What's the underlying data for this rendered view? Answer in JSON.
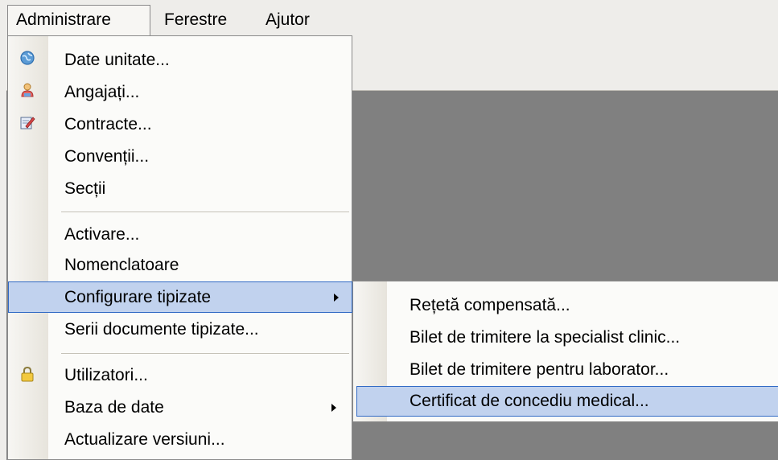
{
  "menubar": {
    "items": [
      {
        "label": "Administrare"
      },
      {
        "label": "Ferestre"
      },
      {
        "label": "Ajutor"
      }
    ]
  },
  "admin_menu": {
    "items": [
      {
        "label": "Date unitate...",
        "icon": "globe-icon"
      },
      {
        "label": "Angajați...",
        "icon": "user-icon"
      },
      {
        "label": "Contracte...",
        "icon": "edit-document-icon"
      },
      {
        "label": "Convenții..."
      },
      {
        "label": "Secții"
      },
      {
        "label": "Activare..."
      },
      {
        "label": "Nomenclatoare"
      },
      {
        "label": "Configurare tipizate",
        "submenu": true,
        "highlighted": true
      },
      {
        "label": "Serii documente tipizate..."
      },
      {
        "label": "Utilizatori...",
        "icon": "lock-icon"
      },
      {
        "label": "Baza de date",
        "submenu": true
      },
      {
        "label": "Actualizare versiuni..."
      }
    ]
  },
  "tipizate_submenu": {
    "items": [
      {
        "label": "Rețetă compensată..."
      },
      {
        "label": "Bilet de trimitere la specialist clinic..."
      },
      {
        "label": "Bilet de trimitere pentru laborator..."
      },
      {
        "label": "Certificat de concediu medical...",
        "highlighted": true
      }
    ]
  },
  "colors": {
    "highlight_fill": "#c1d2ee",
    "highlight_border": "#316ac5",
    "workspace": "#808080"
  }
}
